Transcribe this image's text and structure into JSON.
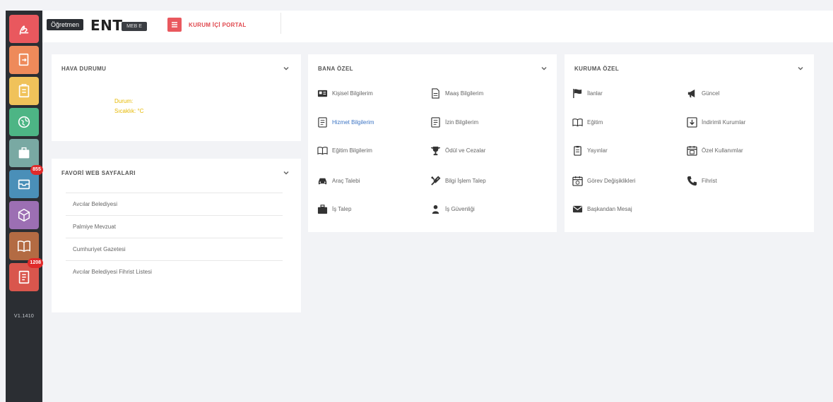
{
  "sidebar": {
    "tooltip": "Öğretmen",
    "buttons": [
      {
        "icon": "signature-icon",
        "color": "#e9585e"
      },
      {
        "icon": "document-arrow-icon",
        "color": "#ee8a5a"
      },
      {
        "icon": "clipboard-icon",
        "color": "#f0c25a"
      },
      {
        "icon": "globe-icon",
        "color": "#4db585"
      },
      {
        "icon": "briefcase-icon",
        "color": "#79a9a3"
      },
      {
        "icon": "inbox-icon",
        "color": "#4a8fb8",
        "badge": "855"
      },
      {
        "icon": "cube-icon",
        "color": "#9c6fb3"
      },
      {
        "icon": "book-icon",
        "color": "#b36b43"
      },
      {
        "icon": "report-icon",
        "color": "#d9564d",
        "badge": "1208"
      }
    ],
    "version": "V1.1410"
  },
  "header": {
    "brand": "ENT",
    "brand_badge": "MEB E",
    "portal_label": "KURUM İÇİ PORTAL"
  },
  "weather": {
    "title": "HAVA DURUMU",
    "line1": "Durum:",
    "line2": "Sıcaklık: °C"
  },
  "favorites": {
    "title": "FAVORİ WEB SAYFALARI",
    "items": [
      "Avcılar Belediyesi",
      "Palmiye Mevzuat",
      "Cumhuriyet Gazetesi",
      "Avcılar Belediyesi Fihrist Listesi"
    ]
  },
  "personal": {
    "title": "BANA ÖZEL",
    "items": [
      {
        "label": "Kişisel Bilgilerim",
        "icon": "id-card-icon"
      },
      {
        "label": "Maaş Bilgilerim",
        "icon": "document-icon"
      },
      {
        "label": "Hizmet Bilgilerim",
        "icon": "list-document-icon"
      },
      {
        "label": "İzin Bilgilerim",
        "icon": "list-document-icon"
      },
      {
        "label": "Eğitim Bilgilerim",
        "icon": "book-icon"
      },
      {
        "label": "Ödül ve Cezalar",
        "icon": "trophy-icon"
      },
      {
        "label": "Araç Talebi",
        "icon": "car-icon"
      },
      {
        "label": "Bilgi İşlem Talep",
        "icon": "tools-icon"
      },
      {
        "label": "İş Talep",
        "icon": "briefcase-icon"
      },
      {
        "label": "İş Güvenliği",
        "icon": "user-icon"
      }
    ]
  },
  "institution": {
    "title": "KURUMA ÖZEL",
    "items": [
      {
        "label": "İlanlar",
        "icon": "flag-icon"
      },
      {
        "label": "Güncel",
        "icon": "megaphone-icon"
      },
      {
        "label": "Eğitim",
        "icon": "book-icon"
      },
      {
        "label": "İndirimli Kurumlar",
        "icon": "download-icon"
      },
      {
        "label": "Yayınlar",
        "icon": "clipboard-icon"
      },
      {
        "label": "Özel Kullanımlar",
        "icon": "calendar-icon"
      },
      {
        "label": "Görev Değişiklikleri",
        "icon": "calendar-icon"
      },
      {
        "label": "Fihrist",
        "icon": "phone-icon"
      },
      {
        "label": "Başkandan Mesaj",
        "icon": "envelope-icon"
      }
    ]
  }
}
